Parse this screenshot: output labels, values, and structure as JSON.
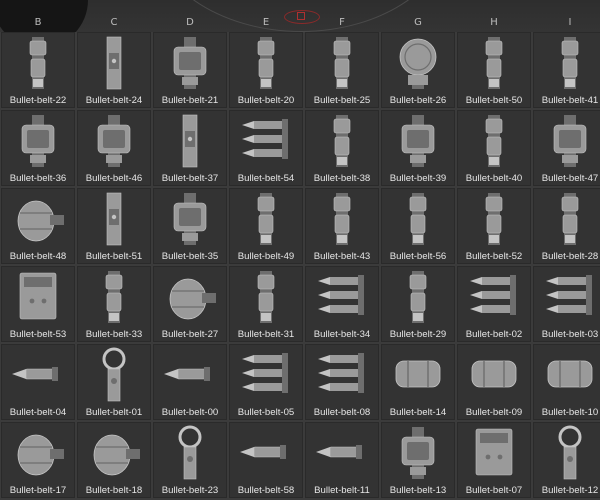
{
  "columns": [
    "B",
    "C",
    "D",
    "E",
    "F",
    "G",
    "H",
    "I"
  ],
  "rows": [
    [
      {
        "label": "Bullet-belt-22",
        "icon": "belt-clip-icon"
      },
      {
        "label": "Bullet-belt-24",
        "icon": "belt-strap-icon"
      },
      {
        "label": "Bullet-belt-21",
        "icon": "belt-buckle-icon"
      },
      {
        "label": "Bullet-belt-20",
        "icon": "belt-clip-icon"
      },
      {
        "label": "Bullet-belt-25",
        "icon": "belt-clip-icon"
      },
      {
        "label": "Bullet-belt-26",
        "icon": "round-plate-icon"
      },
      {
        "label": "Bullet-belt-50",
        "icon": "belt-clip-icon"
      },
      {
        "label": "Bullet-belt-41",
        "icon": "belt-clip-icon"
      }
    ],
    [
      {
        "label": "Bullet-belt-36",
        "icon": "belt-buckle-icon"
      },
      {
        "label": "Bullet-belt-46",
        "icon": "belt-buckle-icon"
      },
      {
        "label": "Bullet-belt-37",
        "icon": "belt-strap-icon"
      },
      {
        "label": "Bullet-belt-54",
        "icon": "bullet-cluster-icon"
      },
      {
        "label": "Bullet-belt-38",
        "icon": "belt-clip-icon"
      },
      {
        "label": "Bullet-belt-39",
        "icon": "belt-buckle-icon"
      },
      {
        "label": "Bullet-belt-40",
        "icon": "belt-clip-icon"
      },
      {
        "label": "Bullet-belt-47",
        "icon": "belt-buckle-icon"
      }
    ],
    [
      {
        "label": "Bullet-belt-48",
        "icon": "grenade-icon"
      },
      {
        "label": "Bullet-belt-51",
        "icon": "belt-strap-icon"
      },
      {
        "label": "Bullet-belt-35",
        "icon": "belt-buckle-icon"
      },
      {
        "label": "Bullet-belt-49",
        "icon": "belt-clip-icon"
      },
      {
        "label": "Bullet-belt-43",
        "icon": "belt-clip-icon"
      },
      {
        "label": "Bullet-belt-56",
        "icon": "belt-clip-icon"
      },
      {
        "label": "Bullet-belt-52",
        "icon": "belt-clip-icon"
      },
      {
        "label": "Bullet-belt-28",
        "icon": "belt-clip-icon"
      }
    ],
    [
      {
        "label": "Bullet-belt-53",
        "icon": "belt-plate-icon"
      },
      {
        "label": "Bullet-belt-33",
        "icon": "belt-clip-icon"
      },
      {
        "label": "Bullet-belt-27",
        "icon": "grenade-icon"
      },
      {
        "label": "Bullet-belt-31",
        "icon": "belt-clip-icon"
      },
      {
        "label": "Bullet-belt-34",
        "icon": "bullet-cluster-icon"
      },
      {
        "label": "Bullet-belt-29",
        "icon": "belt-clip-icon"
      },
      {
        "label": "Bullet-belt-02",
        "icon": "bullet-cluster-icon"
      },
      {
        "label": "Bullet-belt-03",
        "icon": "bullet-cluster-icon"
      }
    ],
    [
      {
        "label": "Bullet-belt-04",
        "icon": "bullet-icon"
      },
      {
        "label": "Bullet-belt-01",
        "icon": "ring-icon"
      },
      {
        "label": "Bullet-belt-00",
        "icon": "bullet-icon"
      },
      {
        "label": "Bullet-belt-05",
        "icon": "bullet-cluster-icon"
      },
      {
        "label": "Bullet-belt-08",
        "icon": "bullet-cluster-icon"
      },
      {
        "label": "Bullet-belt-14",
        "icon": "canister-icon"
      },
      {
        "label": "Bullet-belt-09",
        "icon": "canister-icon"
      },
      {
        "label": "Bullet-belt-10",
        "icon": "canister-icon"
      }
    ],
    [
      {
        "label": "Bullet-belt-17",
        "icon": "grenade-icon"
      },
      {
        "label": "Bullet-belt-18",
        "icon": "grenade-icon"
      },
      {
        "label": "Bullet-belt-23",
        "icon": "ring-icon"
      },
      {
        "label": "Bullet-belt-58",
        "icon": "bullet-icon"
      },
      {
        "label": "Bullet-belt-11",
        "icon": "bullet-icon"
      },
      {
        "label": "Bullet-belt-13",
        "icon": "belt-buckle-icon"
      },
      {
        "label": "Bullet-belt-07",
        "icon": "belt-plate-icon"
      },
      {
        "label": "Bullet-belt-12",
        "icon": "ring-icon"
      }
    ]
  ]
}
